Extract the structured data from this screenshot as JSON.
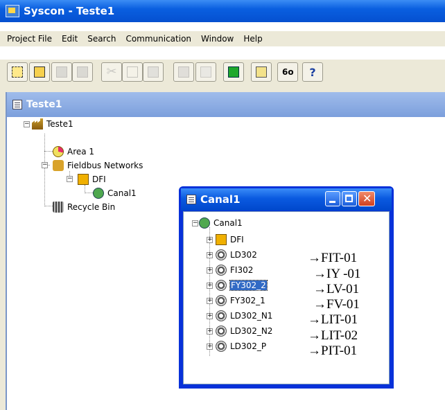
{
  "app": {
    "title": "Syscon - Teste1"
  },
  "menu": [
    "Project File",
    "Edit",
    "Search",
    "Communication",
    "Window",
    "Help"
  ],
  "toolbar": {
    "buttons": [
      {
        "icon": "new-project-icon",
        "enabled": true
      },
      {
        "icon": "open-project-icon",
        "enabled": true
      },
      {
        "icon": "save-icon",
        "enabled": false
      },
      {
        "icon": "save-as-icon",
        "enabled": false
      },
      {
        "icon": "cut-icon",
        "enabled": false
      },
      {
        "icon": "expand-icon",
        "enabled": false
      },
      {
        "icon": "properties-icon",
        "enabled": false
      },
      {
        "icon": "print-icon",
        "enabled": false
      },
      {
        "icon": "keyboard-icon",
        "enabled": false
      },
      {
        "icon": "download-icon",
        "enabled": true
      },
      {
        "icon": "export-icon",
        "enabled": true
      },
      {
        "icon": "glasses-icon",
        "enabled": true
      },
      {
        "icon": "help-icon",
        "label": "?",
        "enabled": true
      }
    ]
  },
  "project_window": {
    "title": "Teste1",
    "tree": {
      "root": "Teste1",
      "area": "Area 1",
      "fieldbus": "Fieldbus Networks",
      "dfi": "DFI",
      "canal": "Canal1",
      "recycle": "Recycle Bin"
    }
  },
  "canal_window": {
    "title": "Canal1",
    "root": "Canal1",
    "items": [
      {
        "label": "DFI",
        "annotation": ""
      },
      {
        "label": "LD302",
        "annotation": "→FIT-01"
      },
      {
        "label": "FI302",
        "annotation": "→IY -01"
      },
      {
        "label": "FY302_2",
        "annotation": "→LV-01",
        "selected": true
      },
      {
        "label": "FY302_1",
        "annotation": "→FV-01"
      },
      {
        "label": "LD302_N1",
        "annotation": "→LIT-01"
      },
      {
        "label": "LD302_N2",
        "annotation": "→LIT-02"
      },
      {
        "label": "LD302_P",
        "annotation": "→PIT-01"
      }
    ]
  },
  "colors": {
    "title_active": "#0a5fe0",
    "title_inactive": "#7c9fdc",
    "selection": "#316ac5"
  }
}
